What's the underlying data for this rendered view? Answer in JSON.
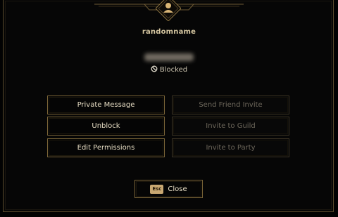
{
  "player": {
    "name": "randomname",
    "status_text": "Blocked",
    "status_icon": "ban-icon",
    "avatar_icon": "user-icon"
  },
  "actions": {
    "private_message": "Private Message",
    "send_friend_invite": "Send Friend Invite",
    "unblock": "Unblock",
    "invite_to_guild": "Invite to Guild",
    "edit_permissions": "Edit Permissions",
    "invite_to_party": "Invite to Party"
  },
  "footer": {
    "close_key": "Esc",
    "close_label": "Close"
  },
  "colors": {
    "background": "#020202",
    "gold_border": "#7a6437",
    "text": "#e6dcc3",
    "disabled_text": "#6d675b",
    "key_badge": "#c9a872"
  }
}
